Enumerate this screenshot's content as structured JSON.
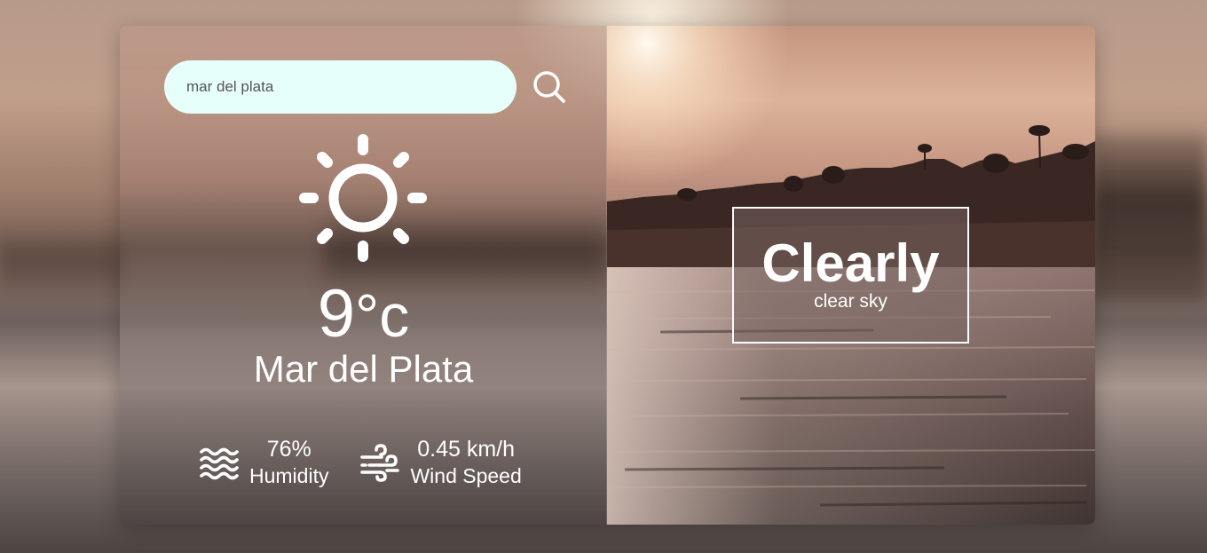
{
  "search": {
    "value": "mar del plata",
    "placeholder": ""
  },
  "search_button": {
    "icon": "search-icon"
  },
  "weather": {
    "icon": "sun-icon",
    "temperature_value": "9",
    "temperature_unit": "°c",
    "city": "Mar del Plata"
  },
  "details": {
    "humidity": {
      "icon": "waves-icon",
      "value": "76%",
      "label": "Humidity"
    },
    "wind": {
      "icon": "wind-icon",
      "value": "0.45 km/h",
      "label": "Wind Speed"
    }
  },
  "condition": {
    "main": "Clearly",
    "description": "clear sky"
  },
  "colors": {
    "search_bg": "#e6fffb",
    "text": "#ffffff"
  }
}
